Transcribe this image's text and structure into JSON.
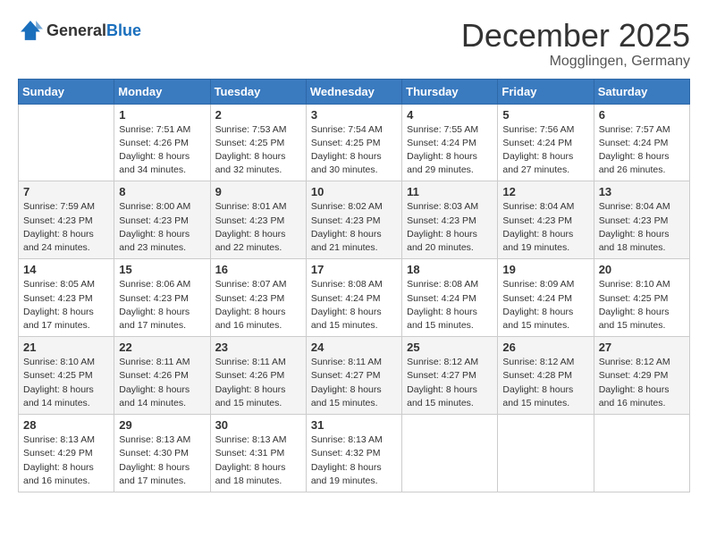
{
  "header": {
    "logo_general": "General",
    "logo_blue": "Blue",
    "month_title": "December 2025",
    "location": "Mogglingen, Germany"
  },
  "days_of_week": [
    "Sunday",
    "Monday",
    "Tuesday",
    "Wednesday",
    "Thursday",
    "Friday",
    "Saturday"
  ],
  "weeks": [
    [
      {
        "day": "",
        "info": ""
      },
      {
        "day": "1",
        "info": "Sunrise: 7:51 AM\nSunset: 4:26 PM\nDaylight: 8 hours\nand 34 minutes."
      },
      {
        "day": "2",
        "info": "Sunrise: 7:53 AM\nSunset: 4:25 PM\nDaylight: 8 hours\nand 32 minutes."
      },
      {
        "day": "3",
        "info": "Sunrise: 7:54 AM\nSunset: 4:25 PM\nDaylight: 8 hours\nand 30 minutes."
      },
      {
        "day": "4",
        "info": "Sunrise: 7:55 AM\nSunset: 4:24 PM\nDaylight: 8 hours\nand 29 minutes."
      },
      {
        "day": "5",
        "info": "Sunrise: 7:56 AM\nSunset: 4:24 PM\nDaylight: 8 hours\nand 27 minutes."
      },
      {
        "day": "6",
        "info": "Sunrise: 7:57 AM\nSunset: 4:24 PM\nDaylight: 8 hours\nand 26 minutes."
      }
    ],
    [
      {
        "day": "7",
        "info": "Sunrise: 7:59 AM\nSunset: 4:23 PM\nDaylight: 8 hours\nand 24 minutes."
      },
      {
        "day": "8",
        "info": "Sunrise: 8:00 AM\nSunset: 4:23 PM\nDaylight: 8 hours\nand 23 minutes."
      },
      {
        "day": "9",
        "info": "Sunrise: 8:01 AM\nSunset: 4:23 PM\nDaylight: 8 hours\nand 22 minutes."
      },
      {
        "day": "10",
        "info": "Sunrise: 8:02 AM\nSunset: 4:23 PM\nDaylight: 8 hours\nand 21 minutes."
      },
      {
        "day": "11",
        "info": "Sunrise: 8:03 AM\nSunset: 4:23 PM\nDaylight: 8 hours\nand 20 minutes."
      },
      {
        "day": "12",
        "info": "Sunrise: 8:04 AM\nSunset: 4:23 PM\nDaylight: 8 hours\nand 19 minutes."
      },
      {
        "day": "13",
        "info": "Sunrise: 8:04 AM\nSunset: 4:23 PM\nDaylight: 8 hours\nand 18 minutes."
      }
    ],
    [
      {
        "day": "14",
        "info": "Sunrise: 8:05 AM\nSunset: 4:23 PM\nDaylight: 8 hours\nand 17 minutes."
      },
      {
        "day": "15",
        "info": "Sunrise: 8:06 AM\nSunset: 4:23 PM\nDaylight: 8 hours\nand 17 minutes."
      },
      {
        "day": "16",
        "info": "Sunrise: 8:07 AM\nSunset: 4:23 PM\nDaylight: 8 hours\nand 16 minutes."
      },
      {
        "day": "17",
        "info": "Sunrise: 8:08 AM\nSunset: 4:24 PM\nDaylight: 8 hours\nand 15 minutes."
      },
      {
        "day": "18",
        "info": "Sunrise: 8:08 AM\nSunset: 4:24 PM\nDaylight: 8 hours\nand 15 minutes."
      },
      {
        "day": "19",
        "info": "Sunrise: 8:09 AM\nSunset: 4:24 PM\nDaylight: 8 hours\nand 15 minutes."
      },
      {
        "day": "20",
        "info": "Sunrise: 8:10 AM\nSunset: 4:25 PM\nDaylight: 8 hours\nand 15 minutes."
      }
    ],
    [
      {
        "day": "21",
        "info": "Sunrise: 8:10 AM\nSunset: 4:25 PM\nDaylight: 8 hours\nand 14 minutes."
      },
      {
        "day": "22",
        "info": "Sunrise: 8:11 AM\nSunset: 4:26 PM\nDaylight: 8 hours\nand 14 minutes."
      },
      {
        "day": "23",
        "info": "Sunrise: 8:11 AM\nSunset: 4:26 PM\nDaylight: 8 hours\nand 15 minutes."
      },
      {
        "day": "24",
        "info": "Sunrise: 8:11 AM\nSunset: 4:27 PM\nDaylight: 8 hours\nand 15 minutes."
      },
      {
        "day": "25",
        "info": "Sunrise: 8:12 AM\nSunset: 4:27 PM\nDaylight: 8 hours\nand 15 minutes."
      },
      {
        "day": "26",
        "info": "Sunrise: 8:12 AM\nSunset: 4:28 PM\nDaylight: 8 hours\nand 15 minutes."
      },
      {
        "day": "27",
        "info": "Sunrise: 8:12 AM\nSunset: 4:29 PM\nDaylight: 8 hours\nand 16 minutes."
      }
    ],
    [
      {
        "day": "28",
        "info": "Sunrise: 8:13 AM\nSunset: 4:29 PM\nDaylight: 8 hours\nand 16 minutes."
      },
      {
        "day": "29",
        "info": "Sunrise: 8:13 AM\nSunset: 4:30 PM\nDaylight: 8 hours\nand 17 minutes."
      },
      {
        "day": "30",
        "info": "Sunrise: 8:13 AM\nSunset: 4:31 PM\nDaylight: 8 hours\nand 18 minutes."
      },
      {
        "day": "31",
        "info": "Sunrise: 8:13 AM\nSunset: 4:32 PM\nDaylight: 8 hours\nand 19 minutes."
      },
      {
        "day": "",
        "info": ""
      },
      {
        "day": "",
        "info": ""
      },
      {
        "day": "",
        "info": ""
      }
    ]
  ]
}
